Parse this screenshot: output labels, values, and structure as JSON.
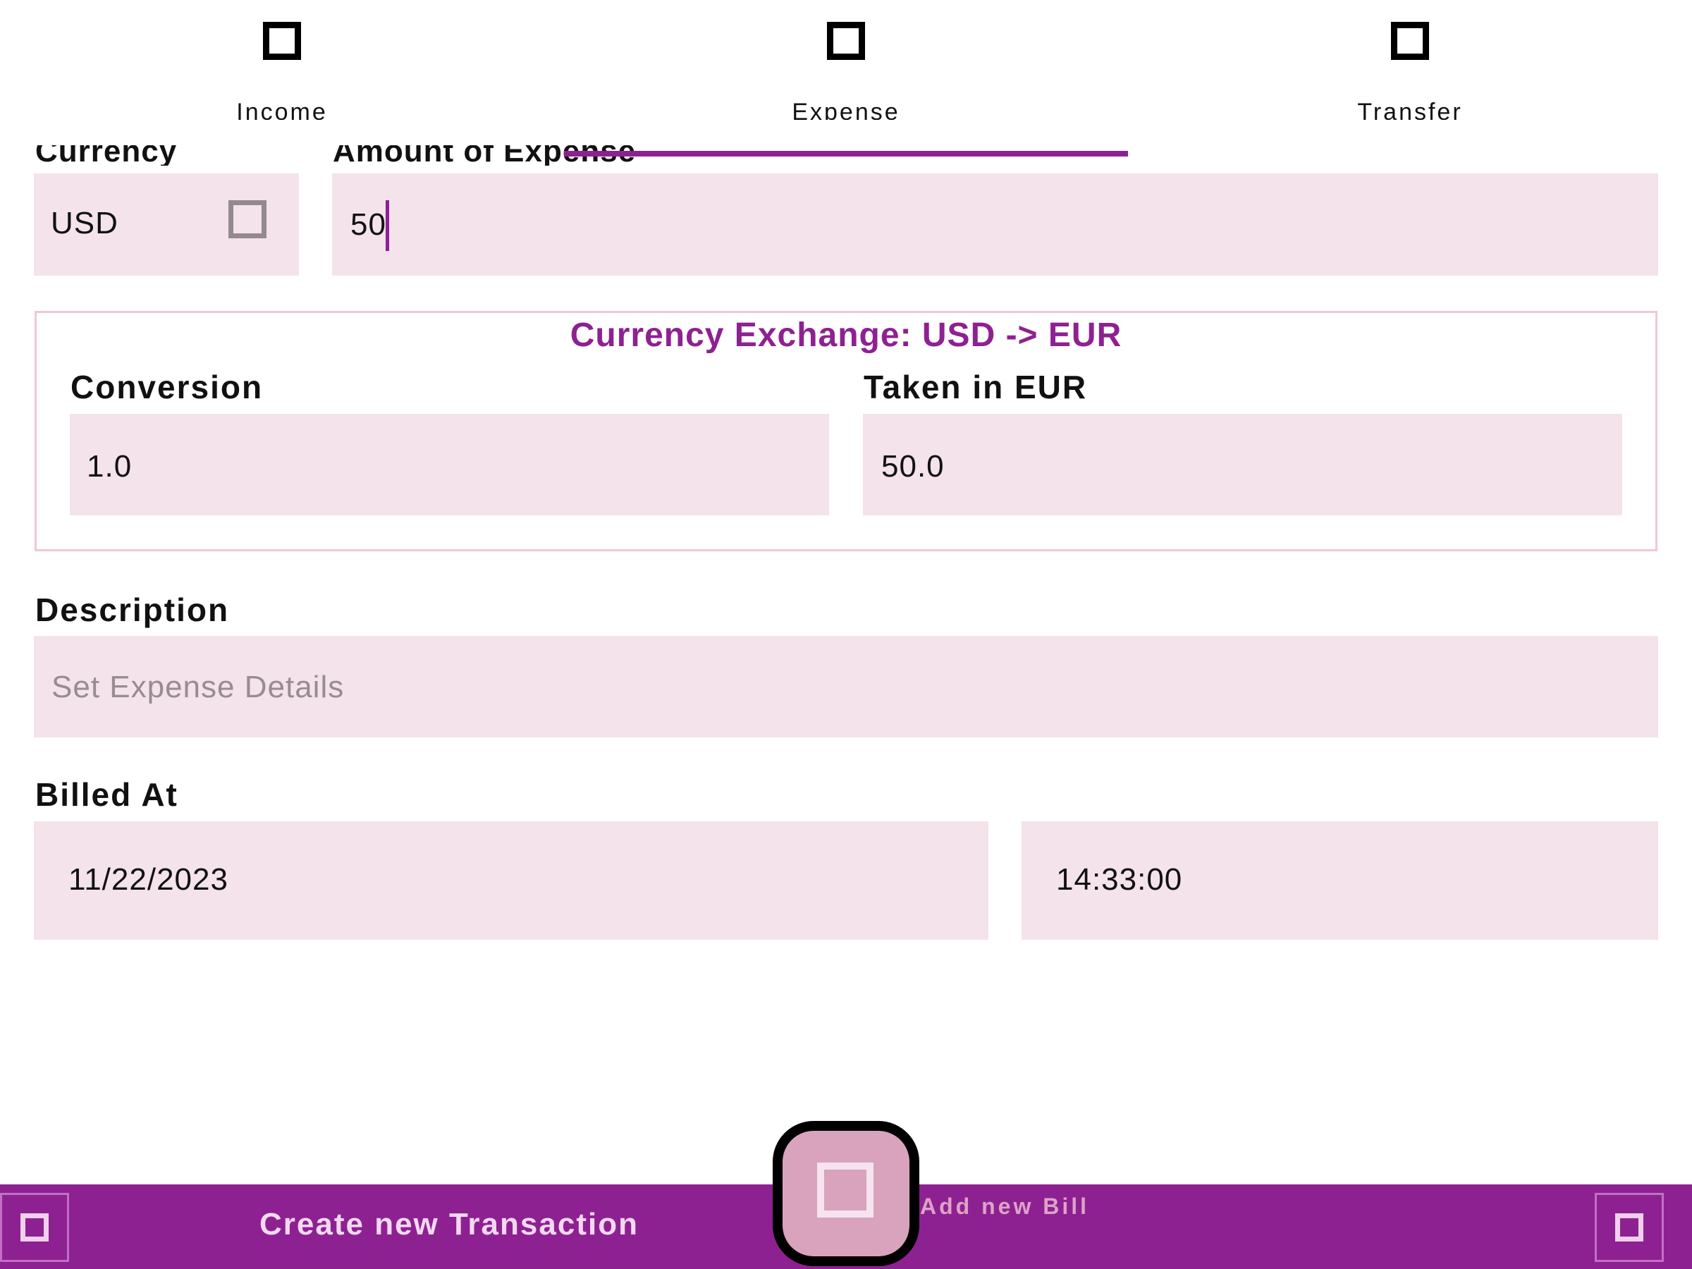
{
  "tabs": [
    {
      "label": "Income",
      "icon": "square-icon"
    },
    {
      "label": "Expense",
      "icon": "square-icon",
      "selected": true
    },
    {
      "label": "Transfer",
      "icon": "square-icon"
    }
  ],
  "form": {
    "currency_label": "Currency",
    "currency_value": "USD",
    "amount_label": "Amount of Expense",
    "amount_value": "50",
    "exchange": {
      "title": "Currency Exchange: USD -> EUR",
      "conversion_label": "Conversion",
      "conversion_value": "1.0",
      "taken_label": "Taken in EUR",
      "taken_value": "50.0"
    },
    "description_label": "Description",
    "description_placeholder": "Set Expense Details",
    "billed_at_label": "Billed At",
    "billed_date": "11/22/2023",
    "billed_time": "14:33:00"
  },
  "bottom_bar": {
    "create_label": "Create new Transaction",
    "add_bill_label": "Add new Bill"
  },
  "colors": {
    "accent": "#8e2191",
    "field_bg": "#f4e3ea",
    "fab_bg": "#d9a2bd"
  }
}
